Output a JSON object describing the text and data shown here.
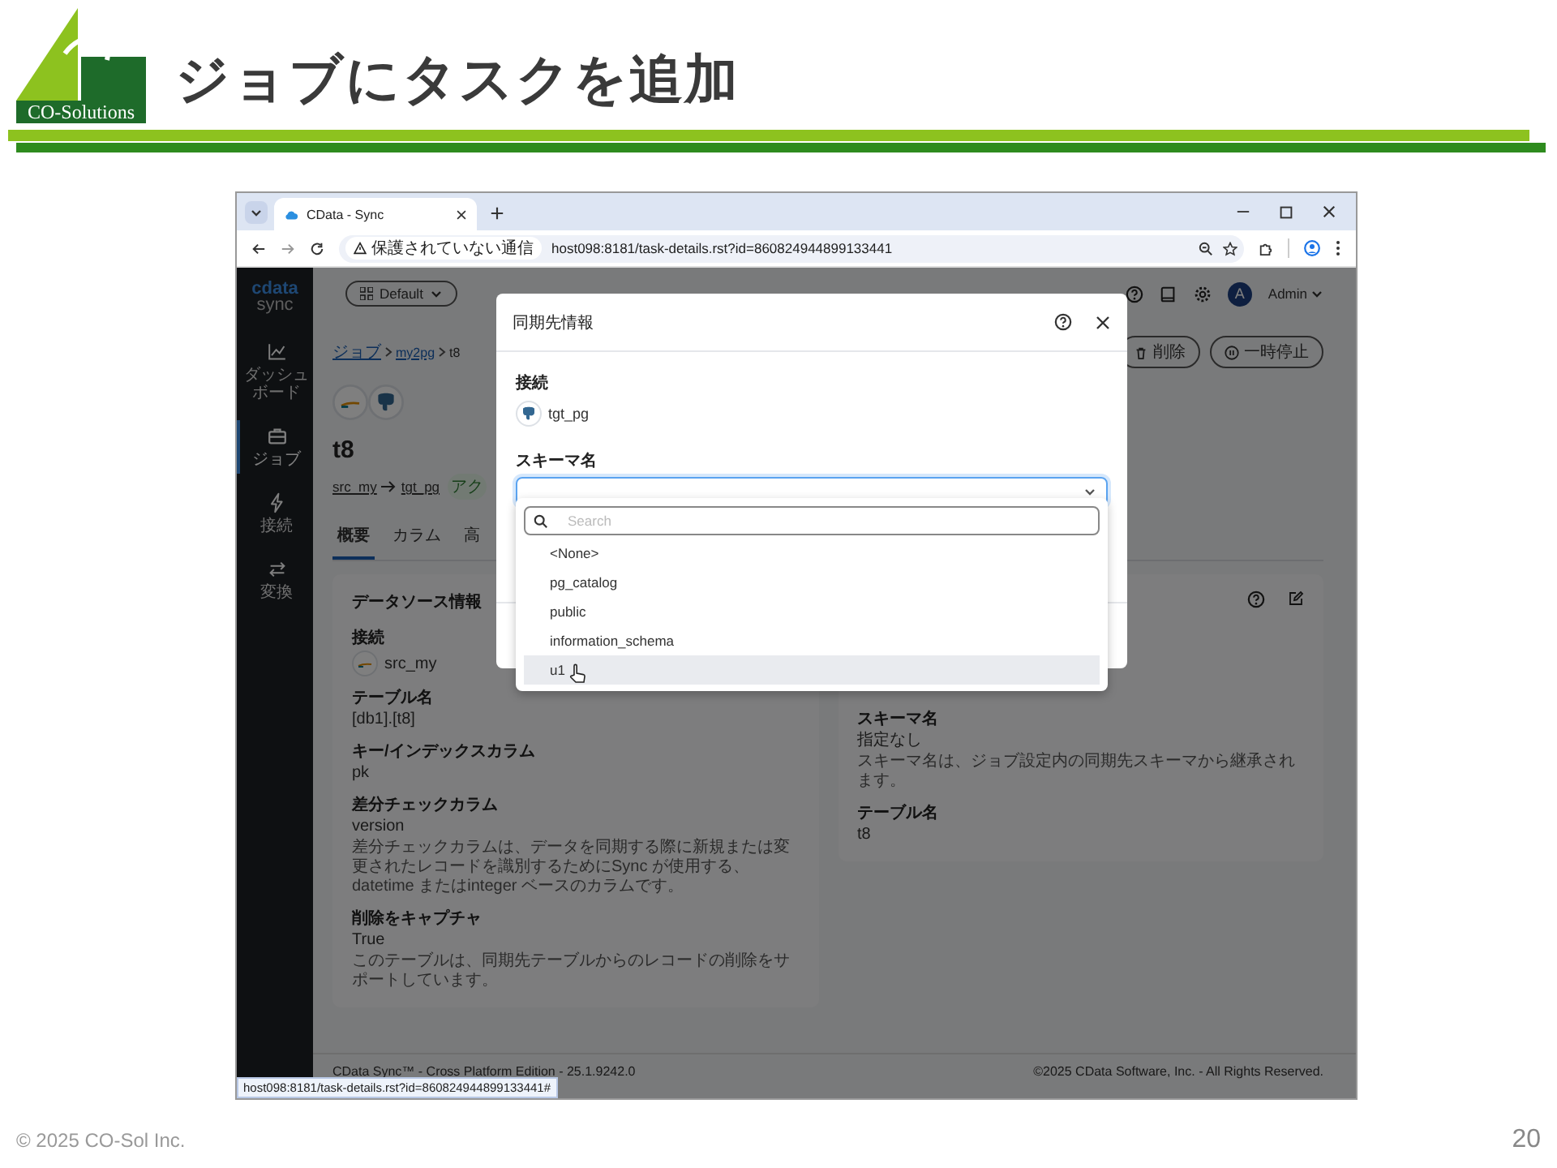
{
  "slide": {
    "logo_text": "CO-Solutions",
    "title": "ジョブにタスクを追加",
    "copyright": "© 2025 CO-Sol Inc.",
    "page_number": "20"
  },
  "browser": {
    "tabs": [
      {
        "title": "CData - Sync",
        "selected": true
      }
    ],
    "security_label": "保護されていない通信",
    "url": "host098:8181/task-details.rst?id=860824944899133441",
    "status_url": "host098:8181/task-details.rst?id=860824944899133441#"
  },
  "app": {
    "logo_text": "cdata",
    "product": "sync",
    "sidebar": [
      {
        "label": "ダッシュボード",
        "selected": false
      },
      {
        "label": "ジョブ",
        "selected": true
      },
      {
        "label": "接続",
        "selected": false
      },
      {
        "label": "変換",
        "selected": false
      }
    ],
    "workspace": "Default",
    "user_initial": "A",
    "user_name": "Admin",
    "breadcrumb": [
      "ジョブ",
      "my2pg",
      "t8"
    ],
    "actions": [
      {
        "label": "削除"
      },
      {
        "label": "一時停止"
      }
    ],
    "task_title": "t8",
    "source": "src_my",
    "target": "tgt_pg",
    "status_badge": "アク",
    "tabs": [
      {
        "label": "概要",
        "selected": true
      },
      {
        "label": "カラム",
        "selected": false
      },
      {
        "label": "高",
        "selected": false
      }
    ],
    "source_card": {
      "title": "データソース情報",
      "fields": [
        {
          "kind": "connection",
          "label": "接続",
          "value": "src_my"
        },
        {
          "kind": "text",
          "label": "テーブル名",
          "value": "[db1].[t8]"
        },
        {
          "kind": "text",
          "label": "キー/インデックスカラム",
          "value": "pk"
        },
        {
          "kind": "text",
          "label": "差分チェックカラム",
          "value": "version",
          "note": "差分チェックカラムは、データを同期する際に新規または変更されたレコードを識別するためにSync が使用する、datetime またはinteger ベースのカラムです。"
        },
        {
          "kind": "text",
          "label": "削除をキャプチャ",
          "value": "True",
          "note": "このテーブルは、同期先テーブルからのレコードの削除をサポートしています。"
        }
      ]
    },
    "target_card": {
      "fields": [
        {
          "kind": "text",
          "label": "スキーマ名",
          "value": "指定なし",
          "note": "スキーマ名は、ジョブ設定内の同期先スキーマから継承されます。"
        },
        {
          "kind": "text",
          "label": "テーブル名",
          "value": "t8"
        }
      ]
    },
    "footer": {
      "version": "CData Sync™ - Cross Platform Edition - 25.1.9242.0",
      "copyright": "©2025 CData Software, Inc. - All Rights Reserved."
    }
  },
  "dialog": {
    "title": "同期先情報",
    "connection_label": "接続",
    "connection": "tgt_pg",
    "schema_label": "スキーマ名",
    "schema_select": {
      "focused": true
    },
    "search_placeholder": "Search",
    "options": [
      {
        "label": "<None>",
        "selected": false
      },
      {
        "label": "pg_catalog",
        "selected": false
      },
      {
        "label": "public",
        "selected": false
      },
      {
        "label": "information_schema",
        "selected": false
      },
      {
        "label": "u1",
        "selected": true
      }
    ]
  }
}
